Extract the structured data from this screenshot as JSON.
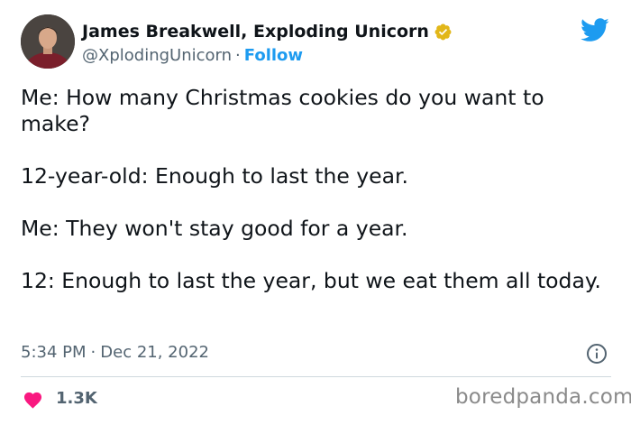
{
  "author": {
    "display_name": "James Breakwell, Exploding Unicorn",
    "handle": "@XplodingUnicorn",
    "separator": "·",
    "follow_label": "Follow"
  },
  "tweet": {
    "text": "Me: How many Christmas cookies do you want to make?\n\n12-year-old: Enough to last the year.\n\nMe: They won't stay good for a year.\n\n12: Enough to last the year, but we eat them all today.",
    "time": "5:34 PM",
    "separator": "·",
    "date": "Dec 21, 2022"
  },
  "engagement": {
    "likes": "1.3K"
  },
  "watermark": "boredpanda.com",
  "colors": {
    "twitter_blue": "#1d9bf0",
    "like_pink": "#f91880",
    "verified_gold": "#e2b719",
    "secondary_text": "#536471"
  },
  "icons": {
    "verified": "verified-badge-icon",
    "brand": "twitter-bird-icon",
    "info": "info-icon",
    "like": "heart-icon"
  }
}
